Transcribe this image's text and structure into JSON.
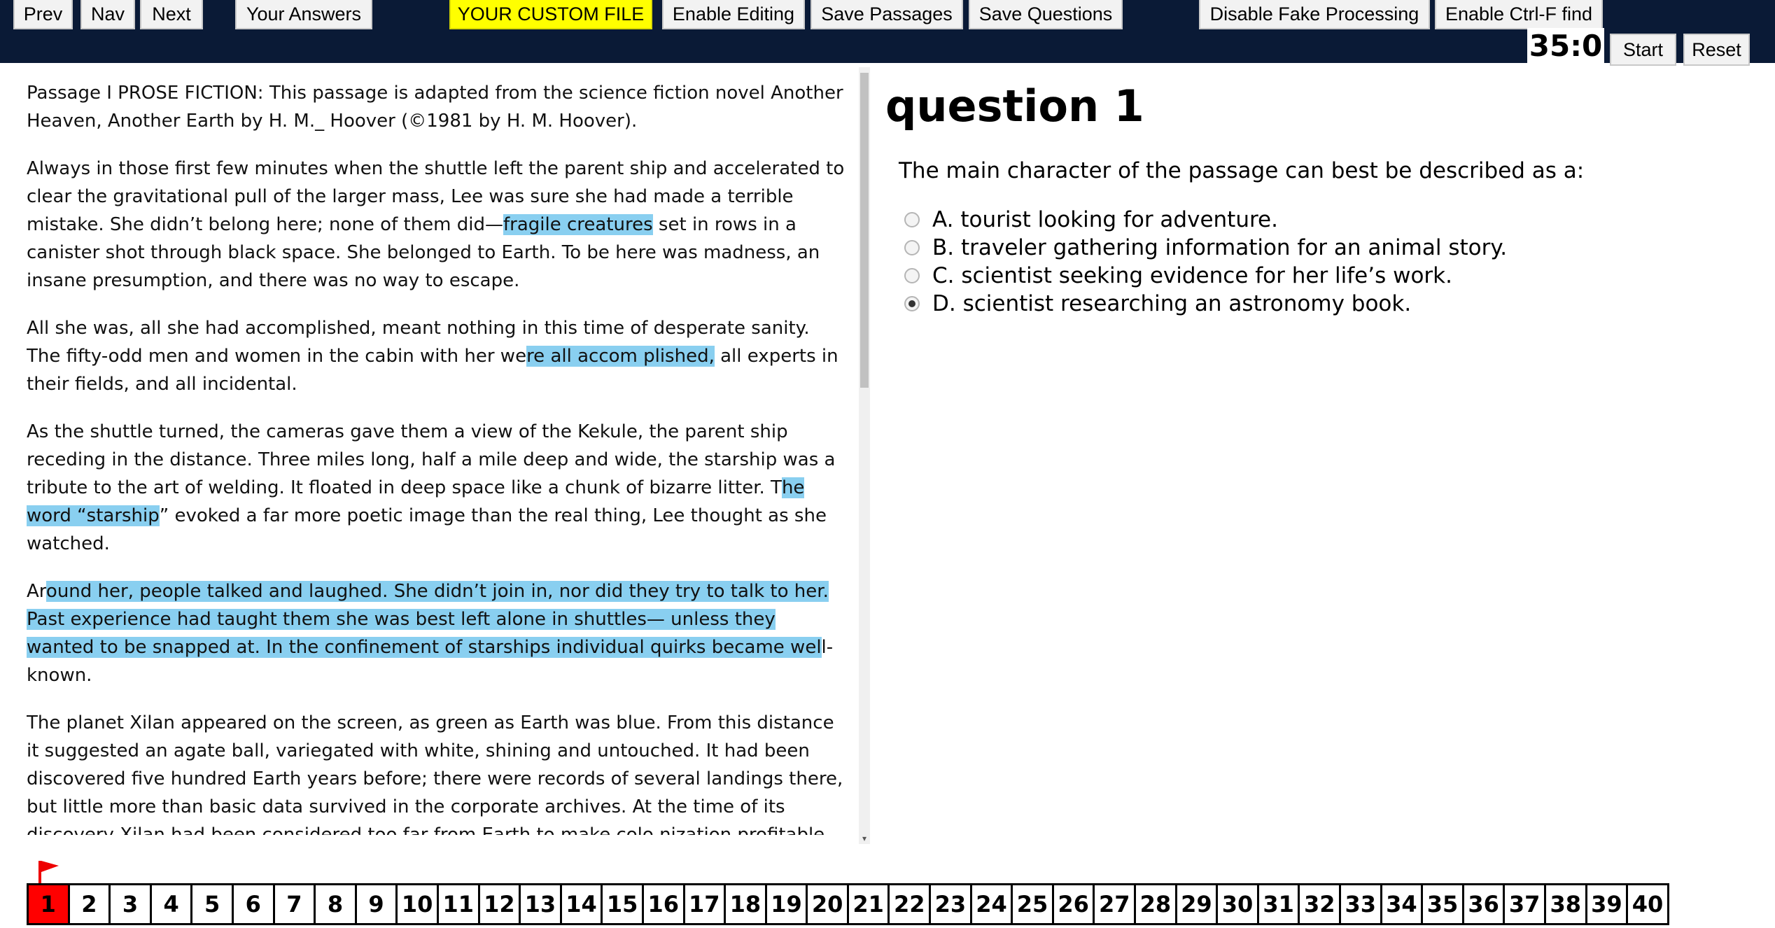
{
  "toolbar": {
    "prev": "Prev",
    "nav": "Nav",
    "next": "Next",
    "your_answers": "Your Answers",
    "custom_file": "YOUR CUSTOM FILE",
    "enable_editing": "Enable Editing",
    "save_passages": "Save Passages",
    "save_questions": "Save Questions",
    "disable_fake": "Disable Fake Processing",
    "enable_ctrlf": "Enable Ctrl-F find",
    "timer": "35:0",
    "start": "Start",
    "reset": "Reset"
  },
  "passage": {
    "intro": "Passage I PROSE FICTION: This passage is adapted from the science fiction novel Another Heaven, Another Earth by H. M._ Hoover (©1981 by H. M. Hoover).",
    "p1": {
      "a": "Always in those first few minutes when the shuttle left the parent ship and accelerated to clear the gravitational pull of the larger mass, Lee was sure she had made a terrible mistake. She didn’t belong here; none of them did—",
      "hl": "fragile creatures",
      "b": " set in rows in a canister shot through black space. She belonged to Earth. To be here was madness, an insane presumption, and there was no way to escape."
    },
    "p2": {
      "a": "All she was, all she had accomplished, meant nothing in this time of desperate sanity. The fifty-odd men and women in the cabin with her we",
      "hl": "re all accom plished,",
      "b": " all experts in their fields, and all incidental."
    },
    "p3": {
      "a": "As the shuttle turned, the cameras gave them a view of the Kekule, the parent ship receding in the distance. Three miles long, half a mile deep and wide, the starship was a tribute to the art of welding. It floated in deep space like a chunk of bizarre litter. T",
      "hl": "he word “starship",
      "b": "” evoked a far more poetic image than the real thing, Lee thought as she watched."
    },
    "p4": {
      "a": "Ar",
      "hl": "ound her, people talked and laughed. She didn’t join in, nor did they try to talk to her. Past experience had taught them she was best left alone in shuttles— unless they wanted to be snapped at. In the confinement of starships individual quirks became wel",
      "b": "l-known."
    },
    "p5": "The planet Xilan appeared on the screen, as green as Earth was blue. From this distance it suggested an agate ball, variegated with white, shining and untouched. It had been discovered five hundred Earth years before; there were records of several landings there, but little more than basic data survived in the corporate archives. At the time of its discovery Xilan had been considered too far from Earth to make colo nization profitable, too far to plunder for mineral wealth. Technology was changing that."
  },
  "question": {
    "title": "question 1",
    "text": "The main character of the passage can best be described as a:",
    "choices": [
      "A. tourist looking for adventure.",
      "B. traveler gathering information for an animal story.",
      "C. scientist seeking evidence for her life’s work.",
      "D. scientist researching an astronomy book."
    ],
    "selected_index": 3
  },
  "nav": {
    "numbers": [
      "1",
      "2",
      "3",
      "4",
      "5",
      "6",
      "7",
      "8",
      "9",
      "10",
      "11",
      "12",
      "13",
      "14",
      "15",
      "16",
      "17",
      "18",
      "19",
      "20",
      "21",
      "22",
      "23",
      "24",
      "25",
      "26",
      "27",
      "28",
      "29",
      "30",
      "31",
      "32",
      "33",
      "34",
      "35",
      "36",
      "37",
      "38",
      "39",
      "40"
    ],
    "current": 1,
    "flagged": [
      1
    ]
  },
  "colors": {
    "topbar": "#0a1a36",
    "highlight": "#89cff0",
    "custom_file": "#ffff00",
    "current_question": "#ff0000"
  }
}
